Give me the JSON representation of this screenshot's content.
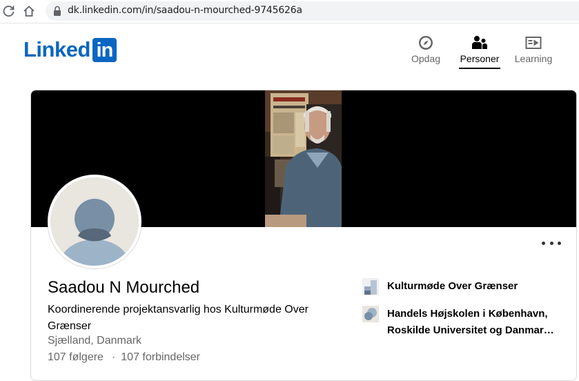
{
  "browser": {
    "url": "dk.linkedin.com/in/saadou-n-mourched-9745626a",
    "icons": [
      "reload-icon",
      "home-icon",
      "lock-icon"
    ]
  },
  "header": {
    "logo_text": "Linked",
    "logo_box_text": "in",
    "brand_color": "#0a66c2",
    "nav": [
      {
        "label": "Opdag",
        "icon": "compass-icon",
        "active": false
      },
      {
        "label": "Personer",
        "icon": "people-icon",
        "active": true
      },
      {
        "label": "Learning",
        "icon": "play-video-icon",
        "active": false
      }
    ]
  },
  "profile": {
    "name": "Saadou N Mourched",
    "headline": "Koordinerende projektansvarlig hos Kulturmøde Over Grænser",
    "location": "Sjælland, Danmark",
    "followers": "107 følgere",
    "separator": "·",
    "connections": "107 forbindelser",
    "more_icon": "more-options-icon"
  },
  "affiliations": [
    {
      "name": "Kulturmøde Over Grænser",
      "icon": "company-logo-icon"
    },
    {
      "name": "Handels Højskolen i København, Roskilde Universitet og Danmar…",
      "icon": "school-logo-icon"
    }
  ]
}
